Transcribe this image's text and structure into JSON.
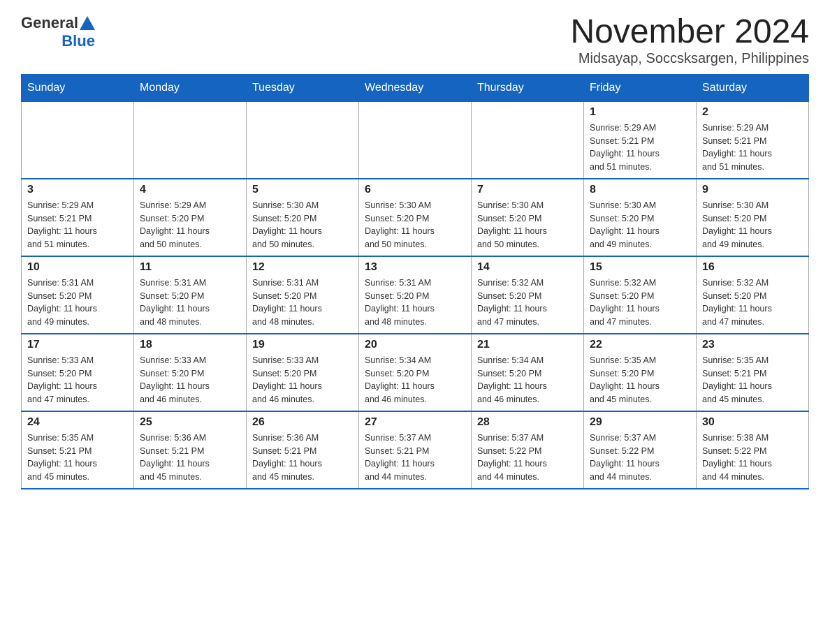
{
  "header": {
    "logo": {
      "general": "General",
      "blue": "Blue"
    },
    "month": "November 2024",
    "location": "Midsayap, Soccsksargen, Philippines"
  },
  "weekdays": [
    "Sunday",
    "Monday",
    "Tuesday",
    "Wednesday",
    "Thursday",
    "Friday",
    "Saturday"
  ],
  "weeks": [
    [
      {
        "day": "",
        "info": ""
      },
      {
        "day": "",
        "info": ""
      },
      {
        "day": "",
        "info": ""
      },
      {
        "day": "",
        "info": ""
      },
      {
        "day": "",
        "info": ""
      },
      {
        "day": "1",
        "info": "Sunrise: 5:29 AM\nSunset: 5:21 PM\nDaylight: 11 hours\nand 51 minutes."
      },
      {
        "day": "2",
        "info": "Sunrise: 5:29 AM\nSunset: 5:21 PM\nDaylight: 11 hours\nand 51 minutes."
      }
    ],
    [
      {
        "day": "3",
        "info": "Sunrise: 5:29 AM\nSunset: 5:21 PM\nDaylight: 11 hours\nand 51 minutes."
      },
      {
        "day": "4",
        "info": "Sunrise: 5:29 AM\nSunset: 5:20 PM\nDaylight: 11 hours\nand 50 minutes."
      },
      {
        "day": "5",
        "info": "Sunrise: 5:30 AM\nSunset: 5:20 PM\nDaylight: 11 hours\nand 50 minutes."
      },
      {
        "day": "6",
        "info": "Sunrise: 5:30 AM\nSunset: 5:20 PM\nDaylight: 11 hours\nand 50 minutes."
      },
      {
        "day": "7",
        "info": "Sunrise: 5:30 AM\nSunset: 5:20 PM\nDaylight: 11 hours\nand 50 minutes."
      },
      {
        "day": "8",
        "info": "Sunrise: 5:30 AM\nSunset: 5:20 PM\nDaylight: 11 hours\nand 49 minutes."
      },
      {
        "day": "9",
        "info": "Sunrise: 5:30 AM\nSunset: 5:20 PM\nDaylight: 11 hours\nand 49 minutes."
      }
    ],
    [
      {
        "day": "10",
        "info": "Sunrise: 5:31 AM\nSunset: 5:20 PM\nDaylight: 11 hours\nand 49 minutes."
      },
      {
        "day": "11",
        "info": "Sunrise: 5:31 AM\nSunset: 5:20 PM\nDaylight: 11 hours\nand 48 minutes."
      },
      {
        "day": "12",
        "info": "Sunrise: 5:31 AM\nSunset: 5:20 PM\nDaylight: 11 hours\nand 48 minutes."
      },
      {
        "day": "13",
        "info": "Sunrise: 5:31 AM\nSunset: 5:20 PM\nDaylight: 11 hours\nand 48 minutes."
      },
      {
        "day": "14",
        "info": "Sunrise: 5:32 AM\nSunset: 5:20 PM\nDaylight: 11 hours\nand 47 minutes."
      },
      {
        "day": "15",
        "info": "Sunrise: 5:32 AM\nSunset: 5:20 PM\nDaylight: 11 hours\nand 47 minutes."
      },
      {
        "day": "16",
        "info": "Sunrise: 5:32 AM\nSunset: 5:20 PM\nDaylight: 11 hours\nand 47 minutes."
      }
    ],
    [
      {
        "day": "17",
        "info": "Sunrise: 5:33 AM\nSunset: 5:20 PM\nDaylight: 11 hours\nand 47 minutes."
      },
      {
        "day": "18",
        "info": "Sunrise: 5:33 AM\nSunset: 5:20 PM\nDaylight: 11 hours\nand 46 minutes."
      },
      {
        "day": "19",
        "info": "Sunrise: 5:33 AM\nSunset: 5:20 PM\nDaylight: 11 hours\nand 46 minutes."
      },
      {
        "day": "20",
        "info": "Sunrise: 5:34 AM\nSunset: 5:20 PM\nDaylight: 11 hours\nand 46 minutes."
      },
      {
        "day": "21",
        "info": "Sunrise: 5:34 AM\nSunset: 5:20 PM\nDaylight: 11 hours\nand 46 minutes."
      },
      {
        "day": "22",
        "info": "Sunrise: 5:35 AM\nSunset: 5:20 PM\nDaylight: 11 hours\nand 45 minutes."
      },
      {
        "day": "23",
        "info": "Sunrise: 5:35 AM\nSunset: 5:21 PM\nDaylight: 11 hours\nand 45 minutes."
      }
    ],
    [
      {
        "day": "24",
        "info": "Sunrise: 5:35 AM\nSunset: 5:21 PM\nDaylight: 11 hours\nand 45 minutes."
      },
      {
        "day": "25",
        "info": "Sunrise: 5:36 AM\nSunset: 5:21 PM\nDaylight: 11 hours\nand 45 minutes."
      },
      {
        "day": "26",
        "info": "Sunrise: 5:36 AM\nSunset: 5:21 PM\nDaylight: 11 hours\nand 45 minutes."
      },
      {
        "day": "27",
        "info": "Sunrise: 5:37 AM\nSunset: 5:21 PM\nDaylight: 11 hours\nand 44 minutes."
      },
      {
        "day": "28",
        "info": "Sunrise: 5:37 AM\nSunset: 5:22 PM\nDaylight: 11 hours\nand 44 minutes."
      },
      {
        "day": "29",
        "info": "Sunrise: 5:37 AM\nSunset: 5:22 PM\nDaylight: 11 hours\nand 44 minutes."
      },
      {
        "day": "30",
        "info": "Sunrise: 5:38 AM\nSunset: 5:22 PM\nDaylight: 11 hours\nand 44 minutes."
      }
    ]
  ]
}
